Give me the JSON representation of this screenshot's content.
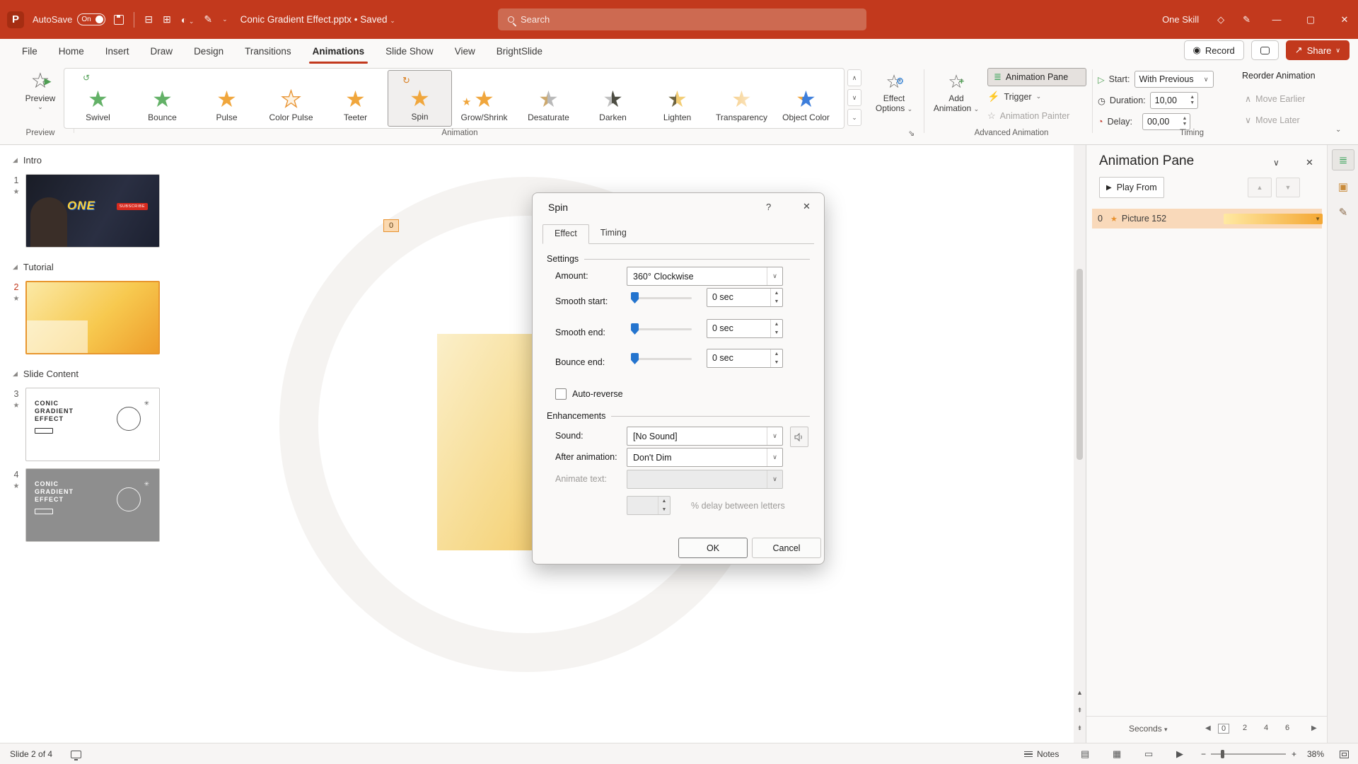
{
  "colors": {
    "accent": "#c2391d",
    "selection_orange": "#e8962e",
    "slider_blue": "#2474ce",
    "star_green": "#63b167",
    "star_orange": "#f0a63c",
    "pane_bar_start": "#ffe9a2",
    "pane_bar_end": "#f4a733"
  },
  "titlebar": {
    "autosave_label": "AutoSave",
    "autosave_state": "On",
    "filename": "Conic Gradient Effect.pptx • Saved",
    "search_placeholder": "Search",
    "user_name": "One Skill"
  },
  "tabs": {
    "selected": "Animations",
    "items": [
      "File",
      "Home",
      "Insert",
      "Draw",
      "Design",
      "Transitions",
      "Animations",
      "Slide Show",
      "View",
      "BrightSlide"
    ]
  },
  "actions": {
    "record": "Record",
    "share": "Share"
  },
  "ribbon": {
    "preview": {
      "label": "Preview",
      "group_label": "Preview"
    },
    "gallery": [
      {
        "label": "Swivel",
        "variant": "swivel"
      },
      {
        "label": "Bounce",
        "variant": "green"
      },
      {
        "label": "Pulse",
        "variant": "orange"
      },
      {
        "label": "Color Pulse",
        "variant": "outline"
      },
      {
        "label": "Teeter",
        "variant": "orange"
      },
      {
        "label": "Spin",
        "variant": "spin",
        "selected": true
      },
      {
        "label": "Grow/Shrink",
        "variant": "grow"
      },
      {
        "label": "Desaturate",
        "variant": "desat"
      },
      {
        "label": "Darken",
        "variant": "dark"
      },
      {
        "label": "Lighten",
        "variant": "light"
      },
      {
        "label": "Transparency",
        "variant": "transp"
      },
      {
        "label": "Object Color",
        "variant": "objcol"
      }
    ],
    "group_animation": "Animation",
    "effect_options_line1": "Effect",
    "effect_options_line2": "Options",
    "add_animation_line1": "Add",
    "add_animation_line2": "Animation",
    "animation_pane": "Animation Pane",
    "trigger": "Trigger",
    "animation_painter": "Animation Painter",
    "group_advanced": "Advanced Animation",
    "timing": {
      "start_label": "Start:",
      "start_value": "With Previous",
      "duration_label": "Duration:",
      "duration_value": "10,00",
      "delay_label": "Delay:",
      "delay_value": "00,00",
      "reorder_label": "Reorder Animation",
      "move_earlier": "Move Earlier",
      "move_later": "Move Later",
      "group_label": "Timing"
    }
  },
  "slides_panel": {
    "sections": [
      {
        "title": "Intro",
        "slides": [
          {
            "num": "1",
            "thumb": "intro",
            "selected": false
          }
        ]
      },
      {
        "title": "Tutorial",
        "slides": [
          {
            "num": "2",
            "thumb": "gradient",
            "selected": true
          }
        ]
      },
      {
        "title": "Slide Content",
        "slides": [
          {
            "num": "3",
            "thumb": "content-light",
            "selected": false
          },
          {
            "num": "4",
            "thumb": "content-dark",
            "selected": false
          }
        ]
      }
    ],
    "thumb_texts": {
      "intro_main": "ONE",
      "intro_badge": "SUBSCRIBE",
      "content_title_lines": [
        "CONIC",
        "GRADIENT",
        "EFFECT"
      ]
    }
  },
  "canvas": {
    "zero_badge": "0"
  },
  "dialog": {
    "title": "Spin",
    "help": "?",
    "close": "✕",
    "tabs": [
      "Effect",
      "Timing"
    ],
    "selected_tab": "Effect",
    "settings_label": "Settings",
    "amount_label": "Amount:",
    "amount_value": "360° Clockwise",
    "smooth_start_label": "Smooth start:",
    "smooth_start_value": "0 sec",
    "smooth_end_label": "Smooth end:",
    "smooth_end_value": "0 sec",
    "bounce_end_label": "Bounce end:",
    "bounce_end_value": "0 sec",
    "auto_reverse_label": "Auto-reverse",
    "enhancements_label": "Enhancements",
    "sound_label": "Sound:",
    "sound_value": "[No Sound]",
    "after_label": "After animation:",
    "after_value": "Don't Dim",
    "animate_text_label": "Animate text:",
    "delay_letters_label": "% delay between letters",
    "ok": "OK",
    "cancel": "Cancel"
  },
  "animation_pane": {
    "title": "Animation Pane",
    "play_from": "Play From",
    "item": {
      "index": "0",
      "name": "Picture 152"
    },
    "timeline": {
      "unit": "Seconds",
      "ticks": [
        "0",
        "2",
        "4",
        "6"
      ]
    }
  },
  "status_bar": {
    "slide_indicator": "Slide 2 of 4",
    "notes_label": "Notes",
    "zoom_level": "38%"
  }
}
